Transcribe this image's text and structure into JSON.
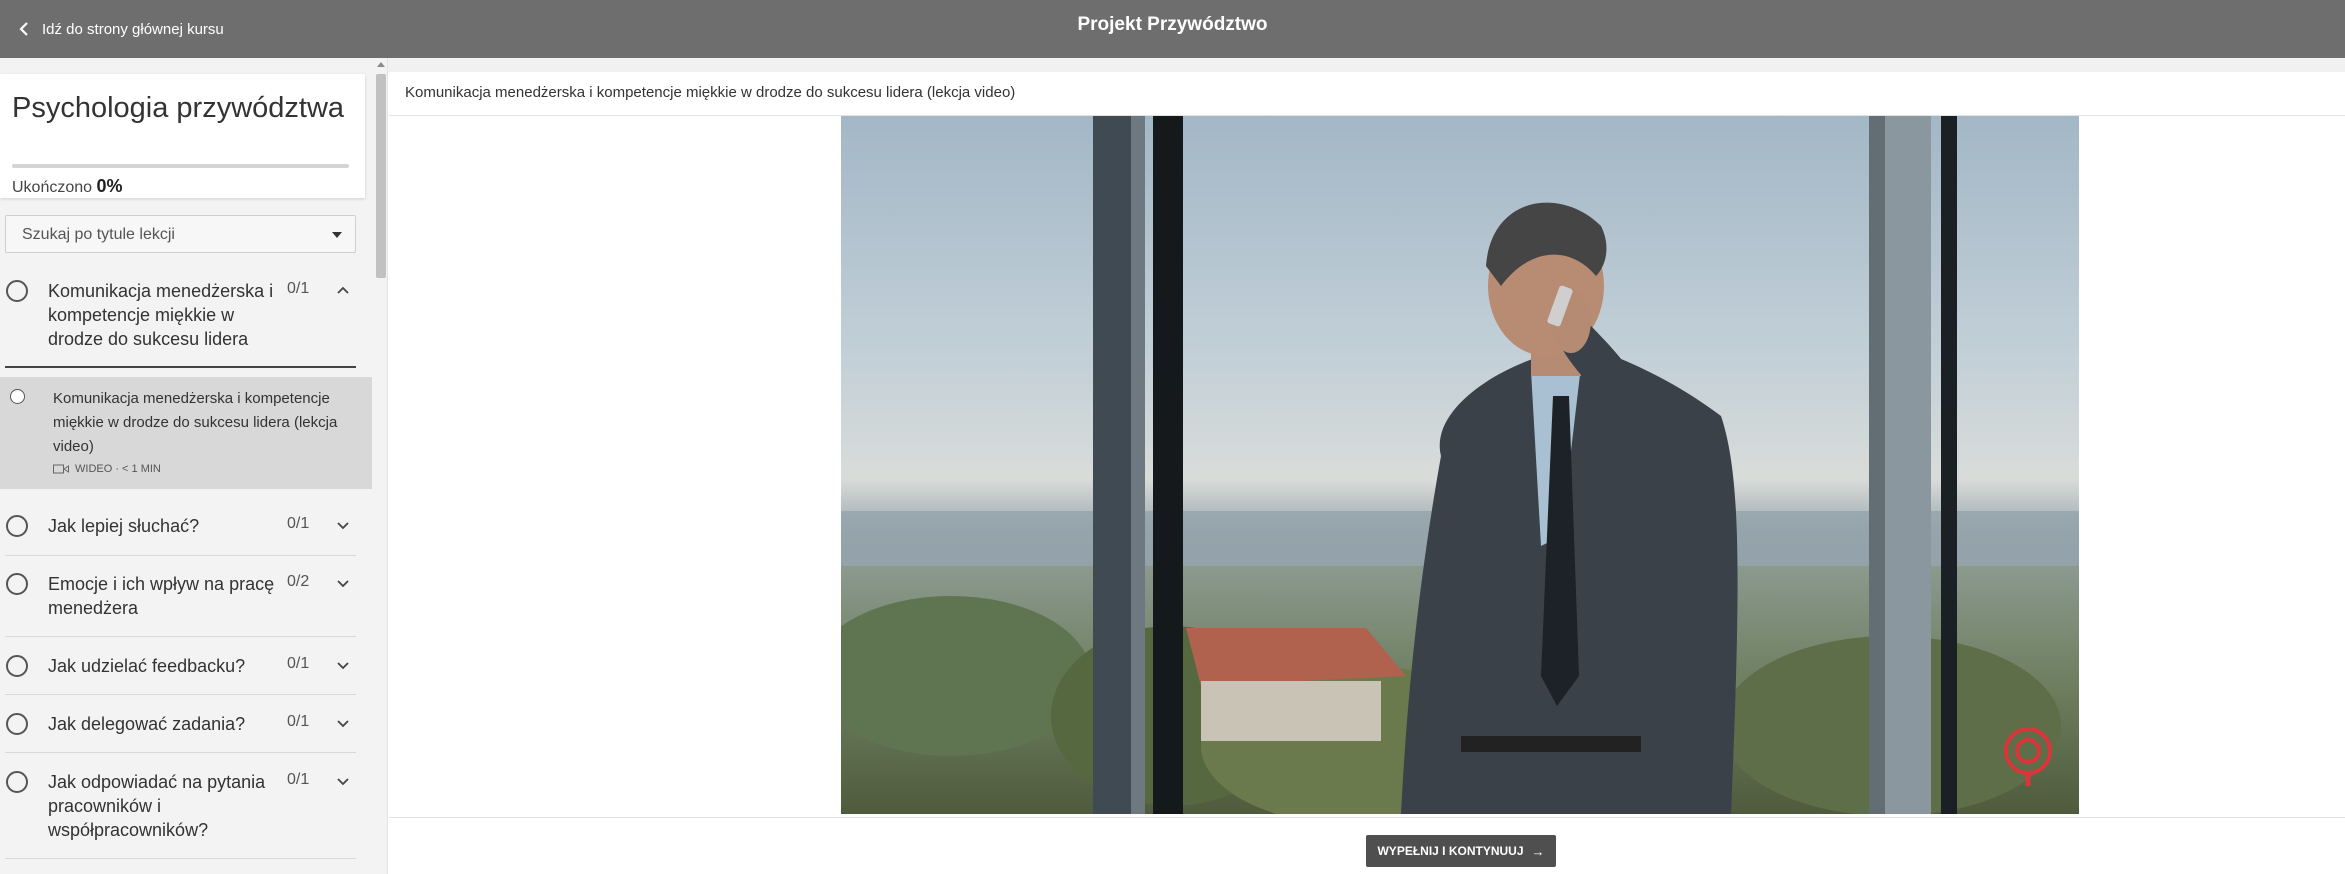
{
  "topbar": {
    "back_label": "Idź do strony głównej kursu",
    "course_title": "Projekt Przywództwo"
  },
  "sidebar": {
    "module_title": "Psychologia przywództwa",
    "completed_label": "Ukończono",
    "completed_value": "0%",
    "progress": 0,
    "search_placeholder": "Szukaj po tytule lekcji",
    "sections": [
      {
        "title": "Komunikacja menedżerska i kompetencje miękkie w drodze do sukcesu lidera",
        "count": "0/1",
        "expanded": true,
        "lessons": [
          {
            "title": "Komunikacja menedżerska i kompetencje miękkie w drodze do sukcesu lidera (lekcja video)",
            "meta": "WIDEO · < 1 MIN"
          }
        ]
      },
      {
        "title": "Jak lepiej słuchać?",
        "count": "0/1",
        "expanded": false
      },
      {
        "title": "Emocje i ich wpływ na pracę menedżera",
        "count": "0/2",
        "expanded": false
      },
      {
        "title": "Jak udzielać feedbacku?",
        "count": "0/1",
        "expanded": false
      },
      {
        "title": "Jak delegować zadania?",
        "count": "0/1",
        "expanded": false
      },
      {
        "title": "Jak odpowiadać na pytania pracowników i współpracowników?",
        "count": "0/1",
        "expanded": false
      }
    ]
  },
  "main": {
    "lesson_title": "Komunikacja menedżerska i kompetencje miękkie w drodze do sukcesu lidera (lekcja video)",
    "continue_label": "WYPEŁNIJ I KONTYNUUJ",
    "continue_arrow": "→"
  },
  "icons": {
    "back": "chevron-left-icon",
    "select_caret": "caret-down-icon",
    "expand_up": "chevron-up-icon",
    "expand_down": "chevron-down-icon",
    "video": "video-camera-icon",
    "watermark": "location-pin-logo-icon"
  },
  "colors": {
    "topbar": "#6e6e6e",
    "sidebar": "#f3f3f3",
    "active_lesson": "#d8d8d8",
    "button": "#4f4f4f",
    "watermark": "#d9353a"
  }
}
